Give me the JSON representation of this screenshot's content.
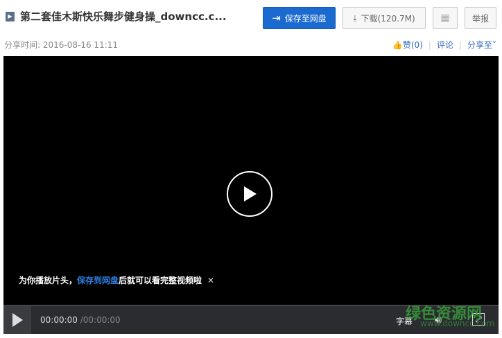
{
  "header": {
    "title": "第二套佳木斯快乐舞步健身操_downcc.c...",
    "save_label": "保存至网盘",
    "download_label": "下载(120.7M)",
    "report_label": "举报"
  },
  "meta": {
    "share_time_label": "分享时间:",
    "share_time": "2016-08-16 11:11",
    "like_label": "赞(0)",
    "comment_label": "评论",
    "share_label": "分享至"
  },
  "player": {
    "notice_prefix": "为你播放片头，",
    "notice_link": "保存到网盘",
    "notice_suffix": "后就可以看完整视频啦",
    "current_time": "00:00:00",
    "total_time": "/00:00:00",
    "subtitle_label": "字幕"
  },
  "watermark": {
    "name": "绿色资源网",
    "url": "www.downcc.com"
  }
}
